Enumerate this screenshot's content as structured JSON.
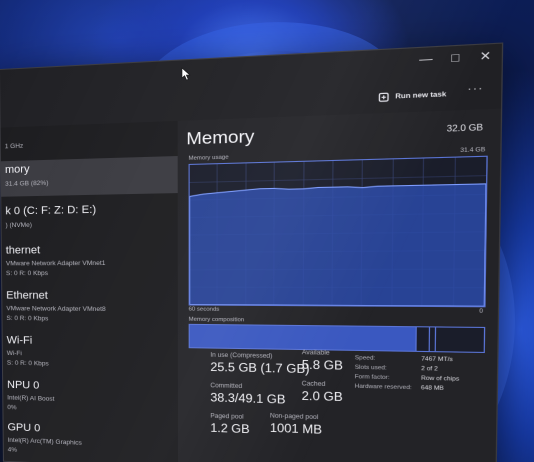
{
  "toolbar": {
    "run_new_task_label": "Run new task",
    "more_label": "···"
  },
  "window_controls": {
    "minimize": "—",
    "maximize": "□",
    "close": "✕"
  },
  "sidebar": {
    "items": [
      {
        "title": "",
        "sub": "1 GHz"
      },
      {
        "title": "mory",
        "sub": "31.4 GB (82%)"
      },
      {
        "title": "k 0 (C: F: Z: D: E:)",
        "sub": ") (NVMe)"
      },
      {
        "title": "thernet",
        "sub": "VMware Network Adapter VMnet1",
        "sub2": "S: 0  R: 0 Kbps"
      },
      {
        "title": "Ethernet",
        "sub": "VMware Network Adapter VMnet8",
        "sub2": "S: 0  R: 0 Kbps"
      },
      {
        "title": "Wi-Fi",
        "sub": "Wi-Fi",
        "sub2": "S: 0  R: 0 Kbps"
      },
      {
        "title": "NPU 0",
        "sub": "Intel(R) AI Boost",
        "sub2": "0%"
      },
      {
        "title": "GPU 0",
        "sub": "Intel(R) Arc(TM) Graphics",
        "sub2": "4%"
      }
    ]
  },
  "memory": {
    "title": "Memory",
    "total": "32.0 GB",
    "usage_label": "Memory usage",
    "usage_max": "31.4 GB",
    "time_label": "60 seconds",
    "time_right": "0",
    "composition_label": "Memory composition",
    "usage_fraction": 0.82,
    "stats": {
      "in_use_label": "In use (Compressed)",
      "in_use_value": "25.5 GB (1.7 GB)",
      "available_label": "Available",
      "available_value": "5.8 GB",
      "committed_label": "Committed",
      "committed_value": "38.3/49.1 GB",
      "cached_label": "Cached",
      "cached_value": "2.0 GB",
      "paged_pool_label": "Paged pool",
      "paged_pool_value": "1.2 GB",
      "non_paged_pool_label": "Non-paged pool",
      "non_paged_pool_value": "1001 MB"
    },
    "details": [
      {
        "key": "Speed:",
        "value": "7467 MT/s"
      },
      {
        "key": "Slots used:",
        "value": "2 of 2"
      },
      {
        "key": "Form factor:",
        "value": "Row of chips"
      },
      {
        "key": "Hardware reserved:",
        "value": "648 MB"
      }
    ]
  },
  "colors": {
    "accent": "#5a74d6",
    "graph_fill": "#2b4aa8",
    "window_bg": "#232327"
  },
  "icons": [
    "run-task-icon",
    "mouse-pointer-icon"
  ]
}
